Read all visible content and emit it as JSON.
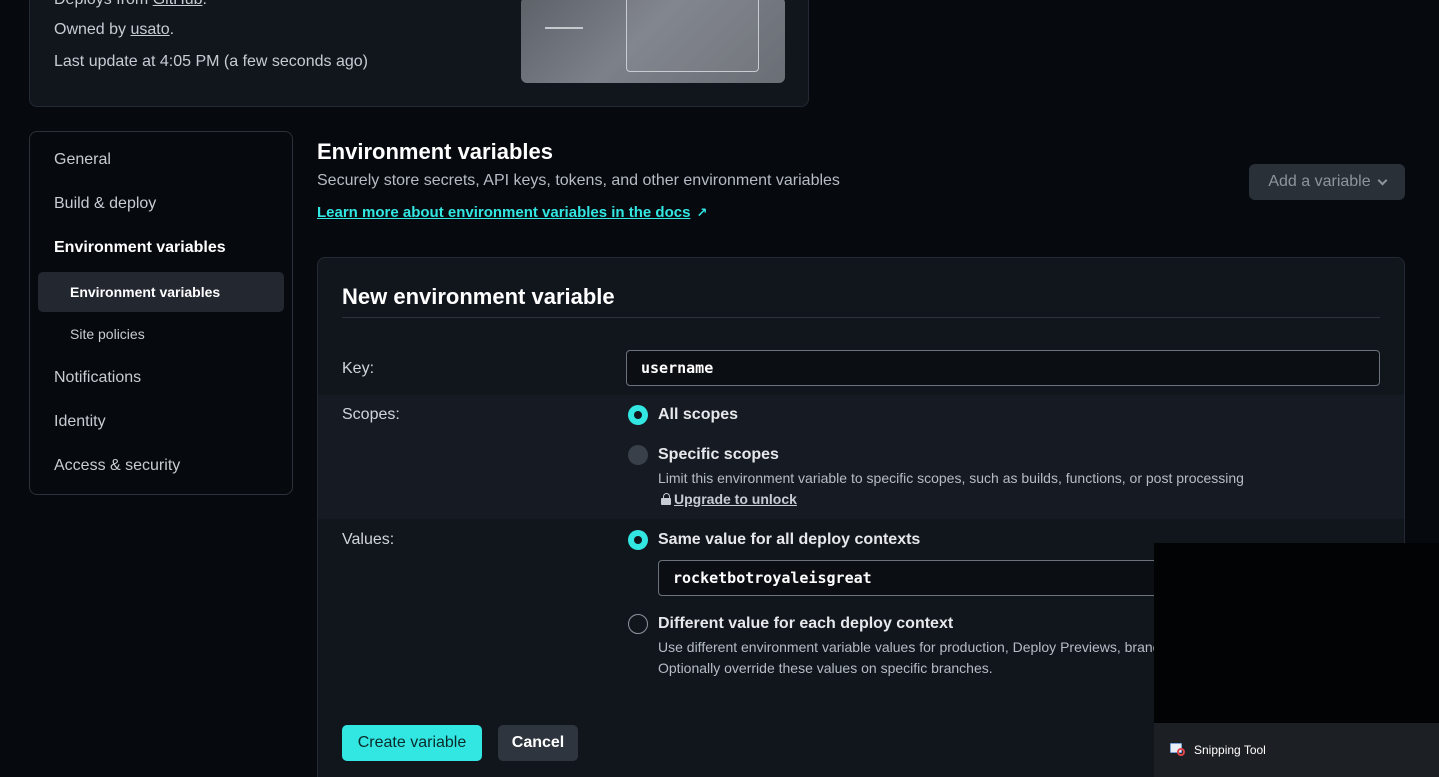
{
  "site_card": {
    "deploys_prefix": "Deploys from ",
    "deploys_link": "GitHub",
    "deploys_suffix": ".",
    "owned_prefix": "Owned by ",
    "owned_link": "usato",
    "owned_suffix": ".",
    "last_update": "Last update at 4:05 PM (a few seconds ago)"
  },
  "sidebar": {
    "items": [
      {
        "label": "General"
      },
      {
        "label": "Build & deploy"
      },
      {
        "label": "Environment variables"
      },
      {
        "label": "Notifications"
      },
      {
        "label": "Identity"
      },
      {
        "label": "Access & security"
      }
    ],
    "subitems": [
      {
        "label": "Environment variables"
      },
      {
        "label": "Site policies"
      }
    ]
  },
  "header": {
    "title": "Environment variables",
    "description": "Securely store secrets, API keys, tokens, and other environment variables",
    "docs_link": "Learn more about environment variables in the docs",
    "docs_link_icon": "↗",
    "add_button": "Add a variable"
  },
  "form": {
    "title": "New environment variable",
    "key_label": "Key:",
    "key_value": "username",
    "scopes_label": "Scopes:",
    "scope_all": "All scopes",
    "scope_specific": "Specific scopes",
    "scope_specific_help": "Limit this environment variable to specific scopes, such as builds, functions, or post processing",
    "upgrade_link": "Upgrade to unlock",
    "values_label": "Values:",
    "value_same": "Same value for all deploy contexts",
    "value_same_input": "rocketbotroyaleisgreat",
    "value_different": "Different value for each deploy context",
    "value_different_help_1": "Use different environment variable values for production, Deploy Previews, branc",
    "value_different_help_2": "Optionally override these values on specific branches.",
    "create_button": "Create variable",
    "cancel_button": "Cancel"
  },
  "overlay": {
    "snipping_tool": "Snipping Tool"
  },
  "colors": {
    "accent": "#32e6e2",
    "background": "#06090d",
    "card": "#11161d"
  }
}
